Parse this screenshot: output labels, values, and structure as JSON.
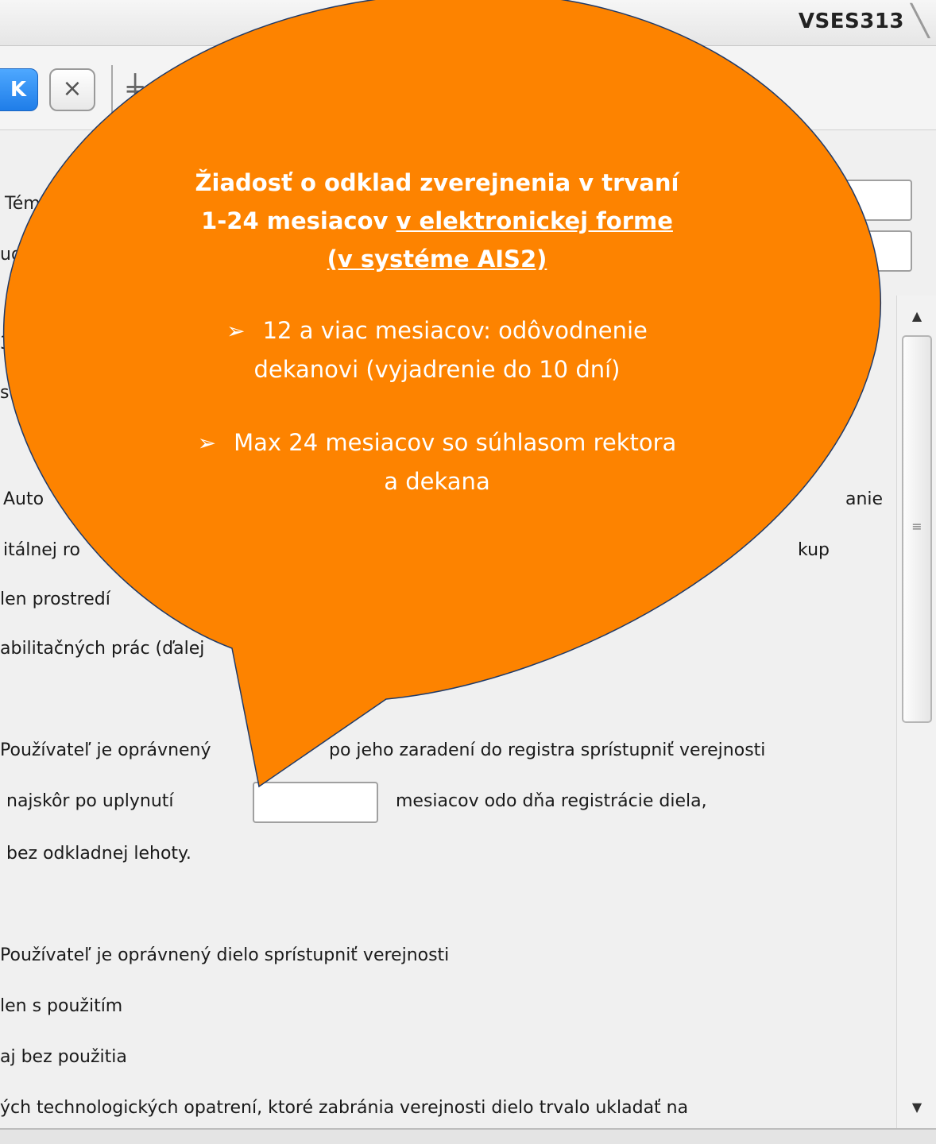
{
  "window": {
    "title": "",
    "tab_label": "VSES313",
    "tab_close": "╲"
  },
  "toolbar": {
    "ok_label": "K",
    "cancel_label": "×",
    "grid_icon": "╪"
  },
  "header": {
    "topic_label": "Téma",
    "student_label": "ud"
  },
  "content": {
    "line_numeral": "3",
    "line_fragment_2": "s",
    "author_fragment": "Auto",
    "line_right_1": "anie",
    "digital_fragment": "itálnej ro",
    "line_right_2": "kup",
    "line_only_via": "len prostredí",
    "habilitation_fragment": "abilitačných prác (ďalej",
    "user_entitled_delay": "Používateľ je oprávnený",
    "user_entitled_delay_rest": "po jeho zaradení do registra sprístupniť verejnosti",
    "earliest_after": "najskôr po uplynutí",
    "months_from_registration": "mesiacov odo dňa registrácie diela,",
    "without_delay": "bez odkladnej lehoty.",
    "user_entitled_public": "Používateľ je oprávnený dielo sprístupniť verejnosti",
    "only_with_use": "len s použitím",
    "also_without_use": "aj bez použitia",
    "tech_measures": "ých technologických opatrení, ktoré zabránia verejnosti dielo trvalo ukladať na"
  },
  "scrollbar": {
    "up_arrow": "▲",
    "down_arrow": "▼",
    "grip": "≡"
  },
  "callout": {
    "title_line1": "Žiadosť o odklad zverejnenia v trvaní",
    "title_line2_plain": "1-24 mesiacov ",
    "title_line2_underlined": "v elektronickej forme",
    "title_line3_underlined": "(v systéme AIS2)",
    "bullet_symbol": "➢",
    "bullet1_line1": "12 a viac mesiacov: odôvodnenie",
    "bullet1_line2": "dekanovi (vyjadrenie do 10 dní)",
    "bullet2_line1": "Max 24 mesiacov so súhlasom rektora",
    "bullet2_line2": "a dekana"
  },
  "colors": {
    "callout_fill": "#fd8300",
    "callout_stroke": "#1f3a68",
    "ok_button": "#2a8cf5"
  }
}
